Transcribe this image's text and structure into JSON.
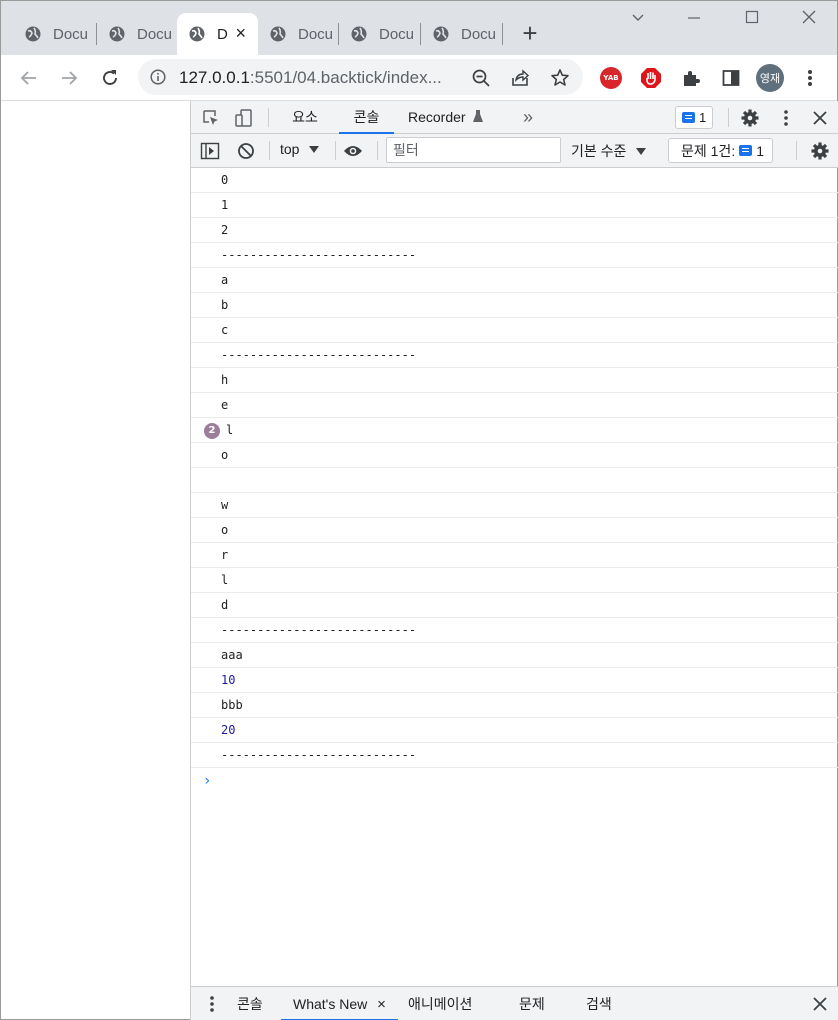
{
  "browser": {
    "tabs": [
      {
        "title": "Docu",
        "active": false
      },
      {
        "title": "Docu",
        "active": false
      },
      {
        "title": "D",
        "active": true
      },
      {
        "title": "Docu",
        "active": false
      },
      {
        "title": "Docu",
        "active": false
      },
      {
        "title": "Docu",
        "active": false
      }
    ],
    "new_tab": "+",
    "close_tab": "×",
    "url_host": "127.0.0.1",
    "url_rest": ":5501/04.backtick/index...",
    "profile_name": "영재",
    "ext_yab": "YAB"
  },
  "devtools": {
    "tabs": {
      "elements": "요소",
      "console": "콘솔",
      "recorder": "Recorder",
      "more": "»"
    },
    "issue_count": "1",
    "context": "top",
    "filter_placeholder": "필터",
    "levels": "기본 수준",
    "issues_label": "문제 1건:",
    "issues_count": "1",
    "console_rows": [
      {
        "text": "0",
        "type": "str"
      },
      {
        "text": "1",
        "type": "str"
      },
      {
        "text": "2",
        "type": "str"
      },
      {
        "text": "---------------------------",
        "type": "str"
      },
      {
        "text": "a",
        "type": "str"
      },
      {
        "text": "b",
        "type": "str"
      },
      {
        "text": "c",
        "type": "str"
      },
      {
        "text": "---------------------------",
        "type": "str"
      },
      {
        "text": "h",
        "type": "str"
      },
      {
        "text": "e",
        "type": "str"
      },
      {
        "text": "l",
        "type": "str",
        "repeat": "2"
      },
      {
        "text": "o",
        "type": "str"
      },
      {
        "text": " ",
        "type": "str"
      },
      {
        "text": "w",
        "type": "str"
      },
      {
        "text": "o",
        "type": "str"
      },
      {
        "text": "r",
        "type": "str"
      },
      {
        "text": "l",
        "type": "str"
      },
      {
        "text": "d",
        "type": "str"
      },
      {
        "text": "---------------------------",
        "type": "str"
      },
      {
        "text": "aaa",
        "type": "str"
      },
      {
        "text": "10",
        "type": "num"
      },
      {
        "text": "bbb",
        "type": "str"
      },
      {
        "text": "20",
        "type": "num"
      },
      {
        "text": "---------------------------",
        "type": "str"
      }
    ],
    "prompt": "›",
    "drawer": {
      "console": "콘솔",
      "whats_new": "What's New",
      "animations": "애니메이션",
      "issues": "문제",
      "search": "검색",
      "close": "×"
    }
  },
  "colors": {
    "accent": "#1a73e8",
    "number": "#1a1aa6",
    "repeat_badge": "#9b7e9b"
  }
}
